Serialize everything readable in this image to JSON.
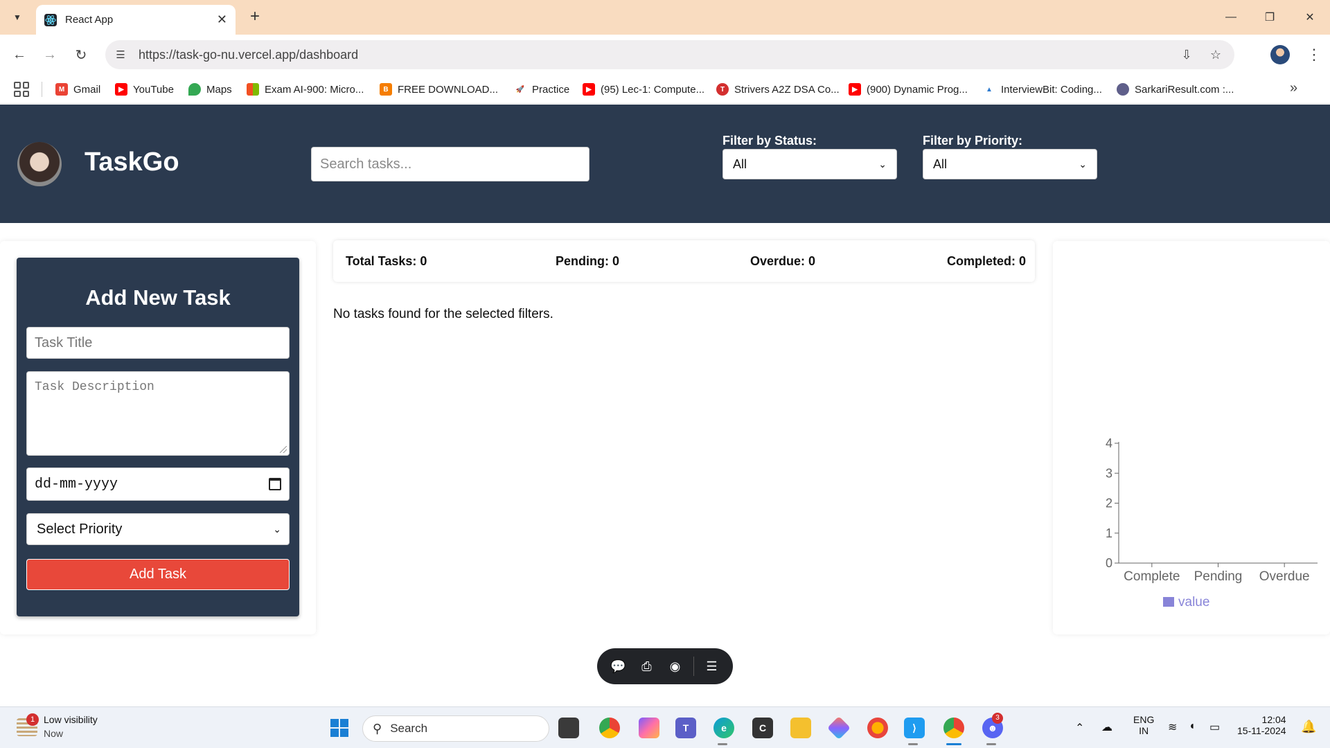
{
  "browser": {
    "tab_title": "React App",
    "url": "https://task-go-nu.vercel.app/dashboard",
    "bookmarks": [
      {
        "label": "Gmail",
        "icon": "gmail-icon"
      },
      {
        "label": "YouTube",
        "icon": "youtube-icon"
      },
      {
        "label": "Maps",
        "icon": "maps-icon"
      },
      {
        "label": "Exam AI-900: Micro...",
        "icon": "microsoft-icon"
      },
      {
        "label": "FREE DOWNLOAD...",
        "icon": "blogger-icon"
      },
      {
        "label": "Practice",
        "icon": "rocket-icon"
      },
      {
        "label": "(95) Lec-1: Compute...",
        "icon": "youtube-icon"
      },
      {
        "label": "Strivers A2Z DSA Co...",
        "icon": "tuf-icon"
      },
      {
        "label": "(900) Dynamic Prog...",
        "icon": "youtube-icon"
      },
      {
        "label": "InterviewBit: Coding...",
        "icon": "interviewbit-icon"
      },
      {
        "label": "SarkariResult.com :...",
        "icon": "globe-icon"
      }
    ]
  },
  "header": {
    "brand": "TaskGo",
    "search_placeholder": "Search tasks...",
    "status_label": "Filter by Status:",
    "status_value": "All",
    "priority_label": "Filter by Priority:",
    "priority_value": "All"
  },
  "form": {
    "title": "Add New Task",
    "title_placeholder": "Task Title",
    "description_placeholder": "Task Description",
    "date_placeholder": "dd-mm-yyyy",
    "priority_placeholder": "Select Priority",
    "submit_label": "Add Task"
  },
  "stats": {
    "total": "Total Tasks: 0",
    "pending": "Pending: 0",
    "overdue": "Overdue: 0",
    "completed": "Completed: 0"
  },
  "empty_message": "No tasks found for the selected filters.",
  "chart_data": {
    "type": "bar",
    "categories": [
      "Complete",
      "Pending",
      "Overdue"
    ],
    "series": [
      {
        "name": "value",
        "values": [
          0,
          0,
          0
        ],
        "color": "#8884d8"
      }
    ],
    "yticks": [
      "0",
      "1",
      "2",
      "3",
      "4"
    ],
    "ylim": [
      0,
      4
    ],
    "legend": "bottom"
  },
  "taskbar": {
    "weather_badge": "1",
    "weather_title": "Low visibility",
    "weather_sub": "Now",
    "search_label": "Search",
    "lang_top": "ENG",
    "lang_bottom": "IN",
    "time": "12:04",
    "date": "15-11-2024",
    "discord_badge": "3"
  }
}
